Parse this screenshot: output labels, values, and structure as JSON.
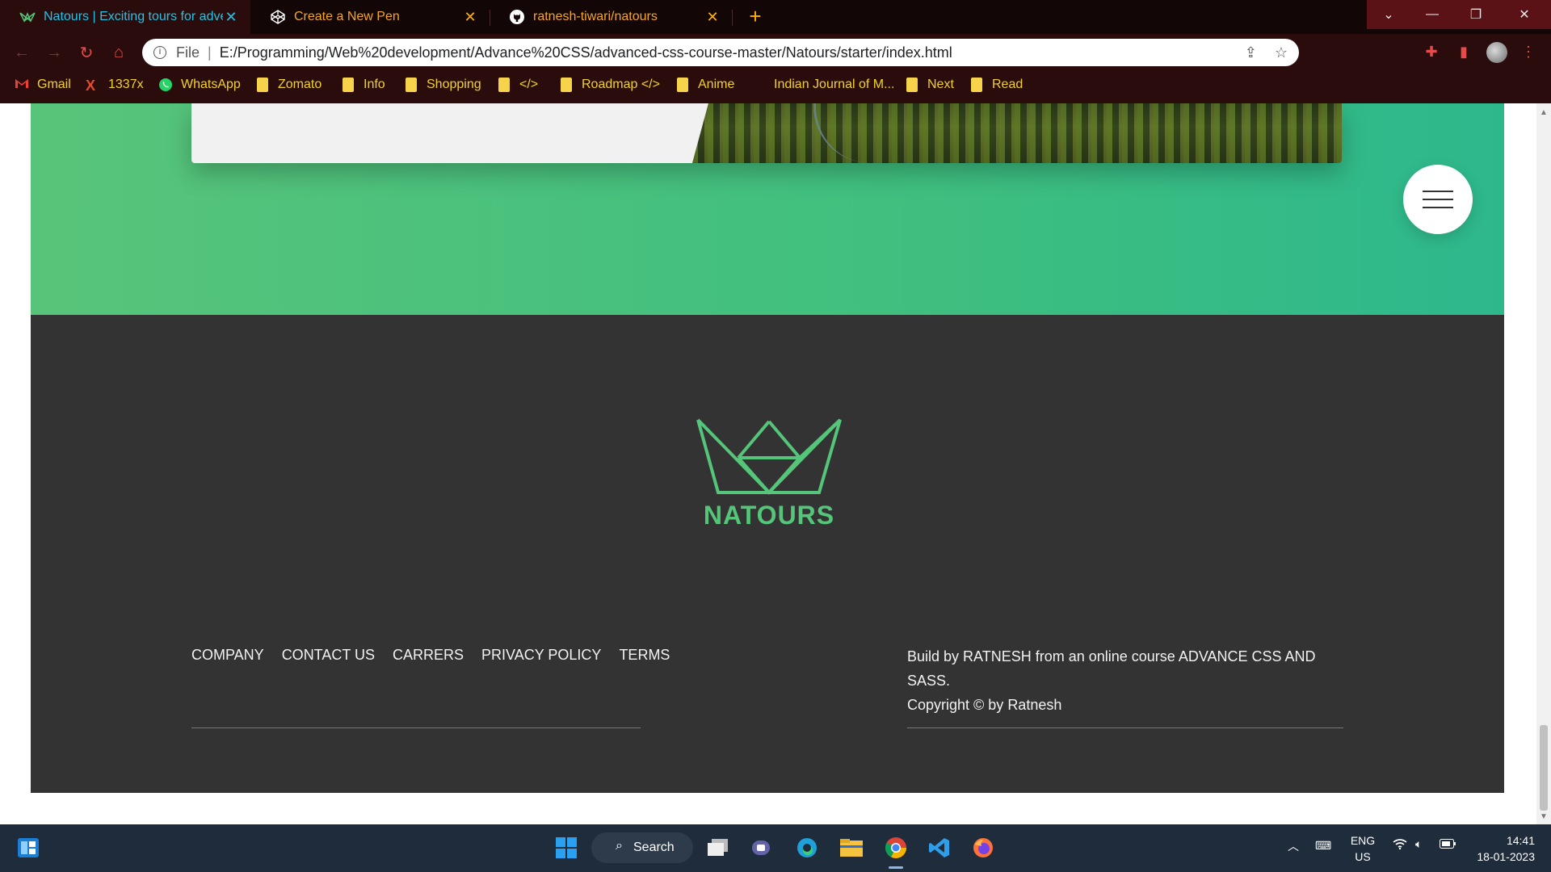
{
  "browser": {
    "tabs": [
      {
        "title": "Natours | Exciting tours for adven",
        "active": true
      },
      {
        "title": "Create a New Pen",
        "active": false
      },
      {
        "title": "ratnesh-tiwari/natours",
        "active": false
      }
    ],
    "new_tab": "+",
    "address": {
      "scheme": "File",
      "separator": "|",
      "url": "E:/Programming/Web%20development/Advance%20CSS/advanced-css-course-master/Natours/starter/index.html"
    },
    "bookmarks": [
      "Gmail",
      "1337x",
      "WhatsApp",
      "Zomato",
      "Info",
      "Shopping",
      "</>",
      "Roadmap </>",
      "Anime",
      "Indian Journal of M...",
      "Next",
      "Read"
    ],
    "window_controls": [
      "chevron-down",
      "minimize",
      "restore",
      "close"
    ]
  },
  "page": {
    "brand": "NATOURS",
    "footer_nav": [
      "COMPANY",
      "CONTACT US",
      "CARRERS",
      "PRIVACY POLICY",
      "TERMS"
    ],
    "copyright_line1": "Build by RATNESH from an online course ADVANCE CSS AND SASS.",
    "copyright_line2": "Copyright © by Ratnesh",
    "colors": {
      "green_light": "#58c47a",
      "green_dark": "#2db88c",
      "footer_bg": "#333333",
      "brand_green": "#55c57a"
    }
  },
  "taskbar": {
    "search_label": "Search",
    "lang_line1": "ENG",
    "lang_line2": "US",
    "time": "14:41",
    "date": "18-01-2023"
  }
}
